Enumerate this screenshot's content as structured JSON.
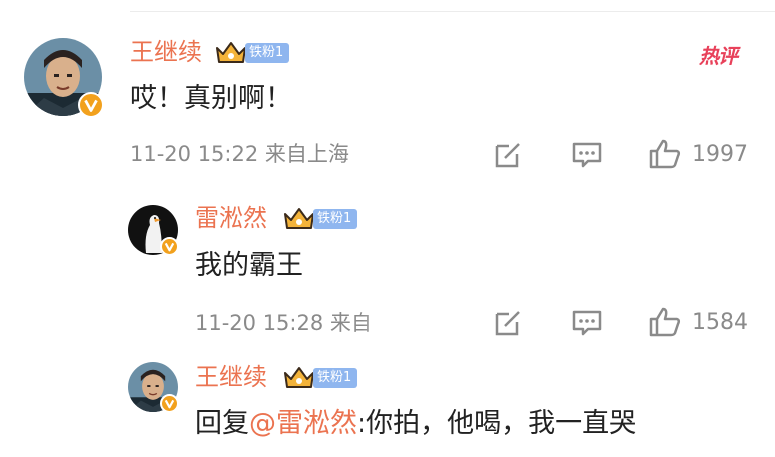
{
  "comment1": {
    "name": "王继续",
    "fan_badge": "铁粉1",
    "hot_label": "热评",
    "text": "哎！真别啊！",
    "meta": "11-20 15:22  来自上海",
    "likes": "1997"
  },
  "reply1": {
    "name": "雷淞然",
    "fan_badge": "铁粉1",
    "text": "我的霸王",
    "meta": "11-20 15:28  来自",
    "likes": "1584"
  },
  "reply2": {
    "name": "王继续",
    "fan_badge": "铁粉1",
    "text_prefix": "回复",
    "mention": "@雷淞然",
    "text": ":你拍，他喝，我一直哭"
  },
  "colors": {
    "name": "#eb7350",
    "fan_badge": "#8fb6ef",
    "hot": "#e8415a",
    "meta": "#8a8a8a"
  }
}
